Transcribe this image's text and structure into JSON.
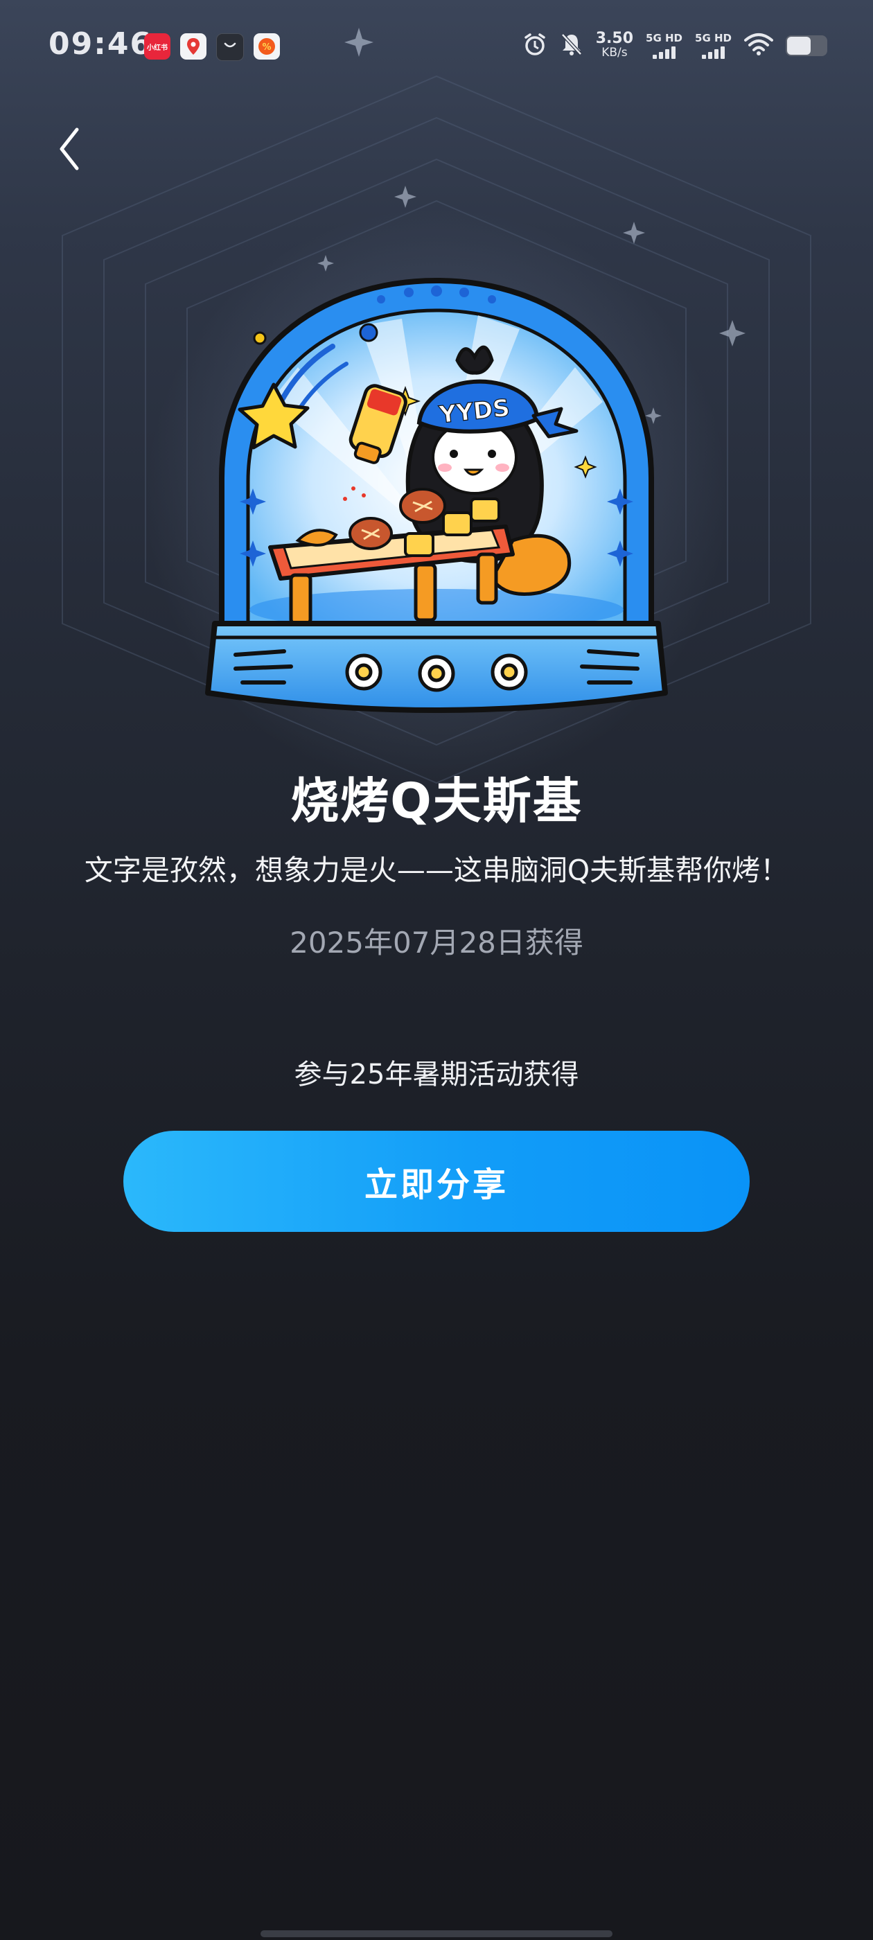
{
  "status_bar": {
    "time": "09:46",
    "notification_icons": [
      "xiaohongshu-app-icon",
      "map-pin-app-icon",
      "shopping-bag-app-icon",
      "orange-coupon-app-icon"
    ],
    "xiaohongshu_text": "小红书",
    "net_speed_value": "3.50",
    "net_speed_unit": "KB/s",
    "sim1_label": "5G HD",
    "sim2_label": "5G HD"
  },
  "badge": {
    "name": "烧烤Q夫斯基",
    "hat_text": "YYDS",
    "description": "文字是孜然，想象力是火——这串脑洞Q夫斯基帮你烤！",
    "obtained_date": "2025年07月28日获得",
    "obtained_via": "参与25年暑期活动获得"
  },
  "actions": {
    "share_label": "立即分享"
  },
  "colors": {
    "accent": "#129df8",
    "background_top": "#3b4559",
    "background_bottom": "#17181d",
    "date_text": "#a3a8b3"
  }
}
